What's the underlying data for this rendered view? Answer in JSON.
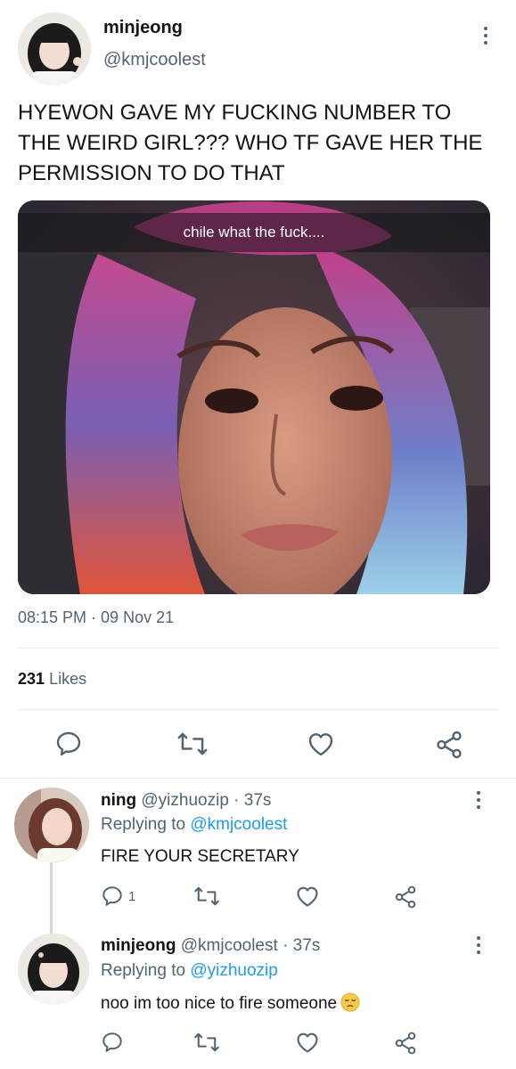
{
  "main_tweet": {
    "author_name": "minjeong",
    "author_handle": "@kmjcoolest",
    "text": "HYEWON GAVE MY FUCKING NUMBER TO THE WEIRD GIRL??? WHO TF GAVE HER THE PERMISSION TO DO THAT",
    "media_caption": "chile what the fuck....",
    "timestamp": "08:15 PM · 09 Nov 21",
    "likes_count": "231",
    "likes_label": "Likes",
    "actions": [
      "reply-icon",
      "retweet-icon",
      "like-icon",
      "share-icon"
    ]
  },
  "replies": [
    {
      "author_name": "ning",
      "author_handle": "@yizhuozip",
      "time": "· 37s",
      "replying_label": "Replying to",
      "replying_to": "@kmjcoolest",
      "text": "FIRE YOUR SECRETARY",
      "reply_count": "1"
    },
    {
      "author_name": "minjeong",
      "author_handle": "@kmjcoolest",
      "time": "· 37s",
      "replying_label": "Replying to",
      "replying_to": "@yizhuozip",
      "text": "noo im too nice to fire someone",
      "emoji": "pensive-face"
    }
  ],
  "colors": {
    "text": "#0f1419",
    "secondary": "#536471",
    "link": "#1d9bf0",
    "divider": "#e6ebef"
  }
}
